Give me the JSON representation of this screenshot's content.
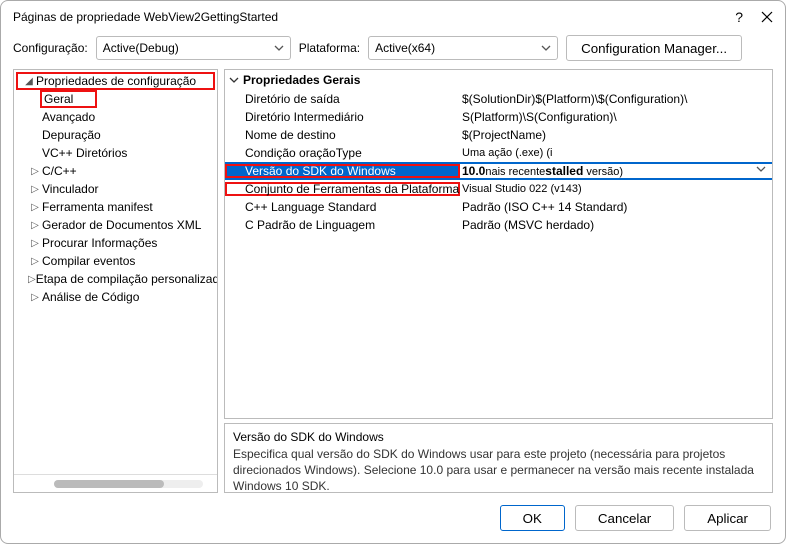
{
  "window": {
    "title": "Páginas de propriedade WebView2GettingStarted"
  },
  "toprow": {
    "config_label": "Configuração:",
    "config_value": "Active(Debug)",
    "platform_label": "Plataforma:",
    "platform_value": "Active(x64)",
    "cfg_mgr": "Configuration Manager..."
  },
  "tree": {
    "root": "Propriedades de configuração",
    "items": [
      {
        "label": "Geral"
      },
      {
        "label": "Avançado"
      },
      {
        "label": "Depuração"
      },
      {
        "label": "VC++ Diretórios"
      },
      {
        "label": "C/C++",
        "expandable": true
      },
      {
        "label": "Vinculador",
        "expandable": true
      },
      {
        "label": "Ferramenta manifest",
        "expandable": true
      },
      {
        "label": "Gerador de Documentos XML",
        "expandable": true
      },
      {
        "label": "Procurar Informações",
        "expandable": true
      },
      {
        "label": "Compilar eventos",
        "expandable": true
      },
      {
        "label": "Etapa de compilação personalizada",
        "expandable": true
      },
      {
        "label": "Análise de Código",
        "expandable": true
      }
    ]
  },
  "grid": {
    "section": "Propriedades Gerais",
    "rows": [
      {
        "name": "Diretório de saída",
        "value": "$(SolutionDir)$(Platform)\\$(Configuration)\\"
      },
      {
        "name": "Diretório Intermediário",
        "value": "S(Platform)\\S(Configuration)\\"
      },
      {
        "name": "Nome de destino",
        "value": "$(ProjectName)"
      },
      {
        "name": "Condição oraçãoType",
        "value": "Uma ação (.exe) (i"
      },
      {
        "name": "Versão do SDK do Windows",
        "value": "10.0nais recentestalled versão)",
        "selected": true
      },
      {
        "name": "Conjunto de Ferramentas da Plataforma",
        "value": "Visual Studio 022 (v143)"
      },
      {
        "name": "C++ Language Standard",
        "value": "Padrão (ISO C++ 14 Standard)"
      },
      {
        "name": "C  Padrão de Linguagem",
        "value": "Padrão (MSVC herdado)"
      }
    ]
  },
  "desc": {
    "title": "Versão do SDK do Windows",
    "text": "Especifica qual versão do SDK do Windows usar para este projeto (necessária para projetos direcionados Windows). Selecione 10.0 para usar e permanecer na versão mais recente instalada Windows 10 SDK."
  },
  "footer": {
    "ok": "OK",
    "cancel": "Cancelar",
    "apply": "Aplicar"
  }
}
